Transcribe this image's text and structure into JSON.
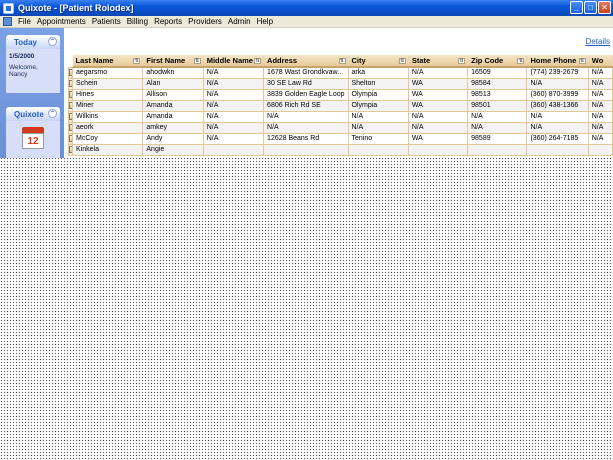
{
  "window": {
    "title": "Quixote - [Patient Rolodex]",
    "controls": {
      "minimize": "_",
      "maximize": "□",
      "close": "✕"
    }
  },
  "menu": [
    "File",
    "Appointments",
    "Patients",
    "Billing",
    "Reports",
    "Providers",
    "Admin",
    "Help"
  ],
  "sidebar": {
    "today": {
      "header": "Today",
      "date": "1/5/2000",
      "welcome_line1": "Welcome,",
      "welcome_line2": "Nancy"
    },
    "quixote": {
      "header": "Quixote",
      "calendar_number": "12"
    }
  },
  "details_link": "Details",
  "table": {
    "columns": [
      "Last Name",
      "First Name",
      "Middle Name",
      "Address",
      "City",
      "State",
      "Zip Code",
      "Home Phone",
      "Wo"
    ],
    "rows": [
      [
        "aegarsmo",
        "ahodwkn",
        "N/A",
        "1678 Wast Grondkvaw...",
        "arka",
        "N/A",
        "16509",
        "(774) 239-2679",
        "N/A"
      ],
      [
        "Schein",
        "Alan",
        "N/A",
        "30 SE Law Rd",
        "Shelton",
        "WA",
        "98584",
        "N/A",
        "N/A"
      ],
      [
        "Hines",
        "Allison",
        "N/A",
        "3839 Golden Eagle Loop",
        "Olympia",
        "WA",
        "98513",
        "(360) 870-3999",
        "N/A"
      ],
      [
        "Miner",
        "Amanda",
        "N/A",
        "6806 Rich Rd SE",
        "Olympia",
        "WA",
        "98501",
        "(360) 438-1366",
        "N/A"
      ],
      [
        "Wilkins",
        "Amanda",
        "N/A",
        "N/A",
        "N/A",
        "N/A",
        "N/A",
        "N/A",
        "N/A"
      ],
      [
        "aeork",
        "amkey",
        "N/A",
        "N/A",
        "N/A",
        "N/A",
        "N/A",
        "N/A",
        "N/A"
      ],
      [
        "McCoy",
        "Andy",
        "N/A",
        "12628 Beans Rd",
        "Tenino",
        "WA",
        "98589",
        "(360) 264-7185",
        "N/A"
      ],
      [
        "Kinkela",
        "Angie",
        "",
        "",
        "",
        "",
        "",
        "",
        ""
      ]
    ]
  }
}
